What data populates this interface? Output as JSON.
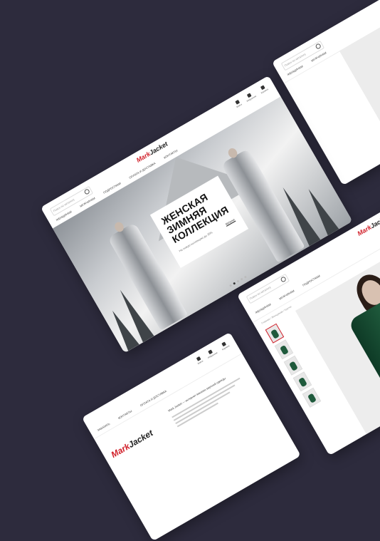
{
  "main": {
    "search_placeholder": "Поиск по каталогу",
    "logo_prefix": "Mark",
    "logo_suffix": "Jacket",
    "nav": [
      "ЖЕНЩИНАМ",
      "МУЖЧИНАМ",
      "ПОДРОСТКАМ",
      "ОПЛАТА И ДОСТАВКА",
      "КОНТАКТЫ"
    ],
    "icons": [
      {
        "name": "user-icon",
        "label": "Войти"
      },
      {
        "name": "heart-icon",
        "label": "Избранное"
      },
      {
        "name": "cart-icon",
        "label": "Корзина"
      }
    ],
    "hero_title_lines": [
      "ЖЕНСКАЯ",
      "ЗИМНЯЯ",
      "КОЛЛЕКЦИЯ"
    ],
    "hero_sub": "На новую коллекцию до 30%",
    "hero_btn": "Каталог",
    "slider_total": 5,
    "slider_active": 1
  },
  "top_right": {
    "search_placeholder": "Поиск по каталогу",
    "nav": [
      "ЖЕНЩИНАМ",
      "МУЖЧИНАМ"
    ]
  },
  "bottom_left": {
    "logo_prefix": "Mark",
    "logo_suffix": "Jacket",
    "nav": [
      "ЗАКАЗАТЬ",
      "КОНТАКТЫ",
      "ОПЛАТА И ДОСТАВКА"
    ],
    "about": "Mark Jacket — интернет-магазин верхней одежды"
  },
  "bottom_right": {
    "search_placeholder": "Поиск по каталогу",
    "logo_prefix": "Mark",
    "logo_suffix": "Jacket",
    "nav": [
      "ЖЕНЩИНАМ",
      "МУЖЧИНАМ",
      "ПОДРОСТКАМ"
    ],
    "crumbs": "Главная / Женщинам / Куртки",
    "thumb_count": 5
  },
  "colors": {
    "background": "#2d2b3d",
    "accent": "#d1202a",
    "jacket": "#1f5a3c"
  }
}
